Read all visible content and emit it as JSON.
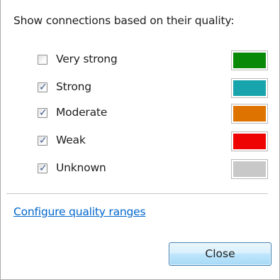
{
  "heading": "Show connections based on their quality:",
  "quality_levels": [
    {
      "label": "Very strong",
      "checked": false,
      "color": "#088a08"
    },
    {
      "label": "Strong",
      "checked": true,
      "color": "#17a4ac"
    },
    {
      "label": "Moderate",
      "checked": true,
      "color": "#df7300"
    },
    {
      "label": "Weak",
      "checked": true,
      "color": "#ef0404"
    },
    {
      "label": "Unknown",
      "checked": true,
      "color": "#c8c8c8"
    }
  ],
  "configure_link": "Configure quality ranges",
  "close_button": "Close"
}
